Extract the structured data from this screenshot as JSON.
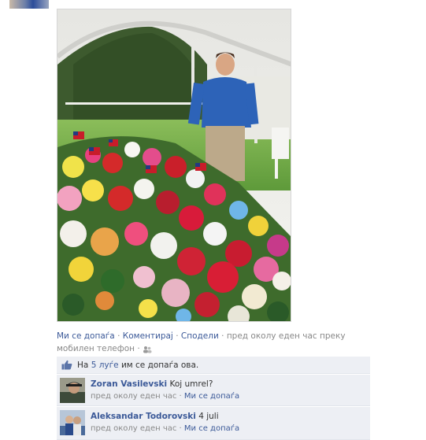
{
  "post": {
    "actions": {
      "like": "Ми се допаѓа",
      "comment": "Коментирај",
      "share": "Сподели",
      "meta": "пред околу еден час преку мобилен телефон"
    },
    "likes": {
      "prefix": "На",
      "count": "5 луѓе",
      "suffix": "им се допаѓа ова."
    }
  },
  "comments": [
    {
      "author": "Zoran Vasilevski",
      "text": "Koj umrel?",
      "time": "пред околу еден час",
      "like": "Ми се допаѓа"
    },
    {
      "author": "Aleksandar Todorovski",
      "text": "4 juli",
      "time": "пред околу еден час",
      "like": "Ми се допаѓа"
    }
  ],
  "icons": {
    "thumb": "thumbs-up-icon",
    "mobile": "mobile-people-icon",
    "flag": "us-flag"
  },
  "colors": {
    "link": "#3b5998",
    "meta": "#888888",
    "box_bg": "#edeff4"
  }
}
